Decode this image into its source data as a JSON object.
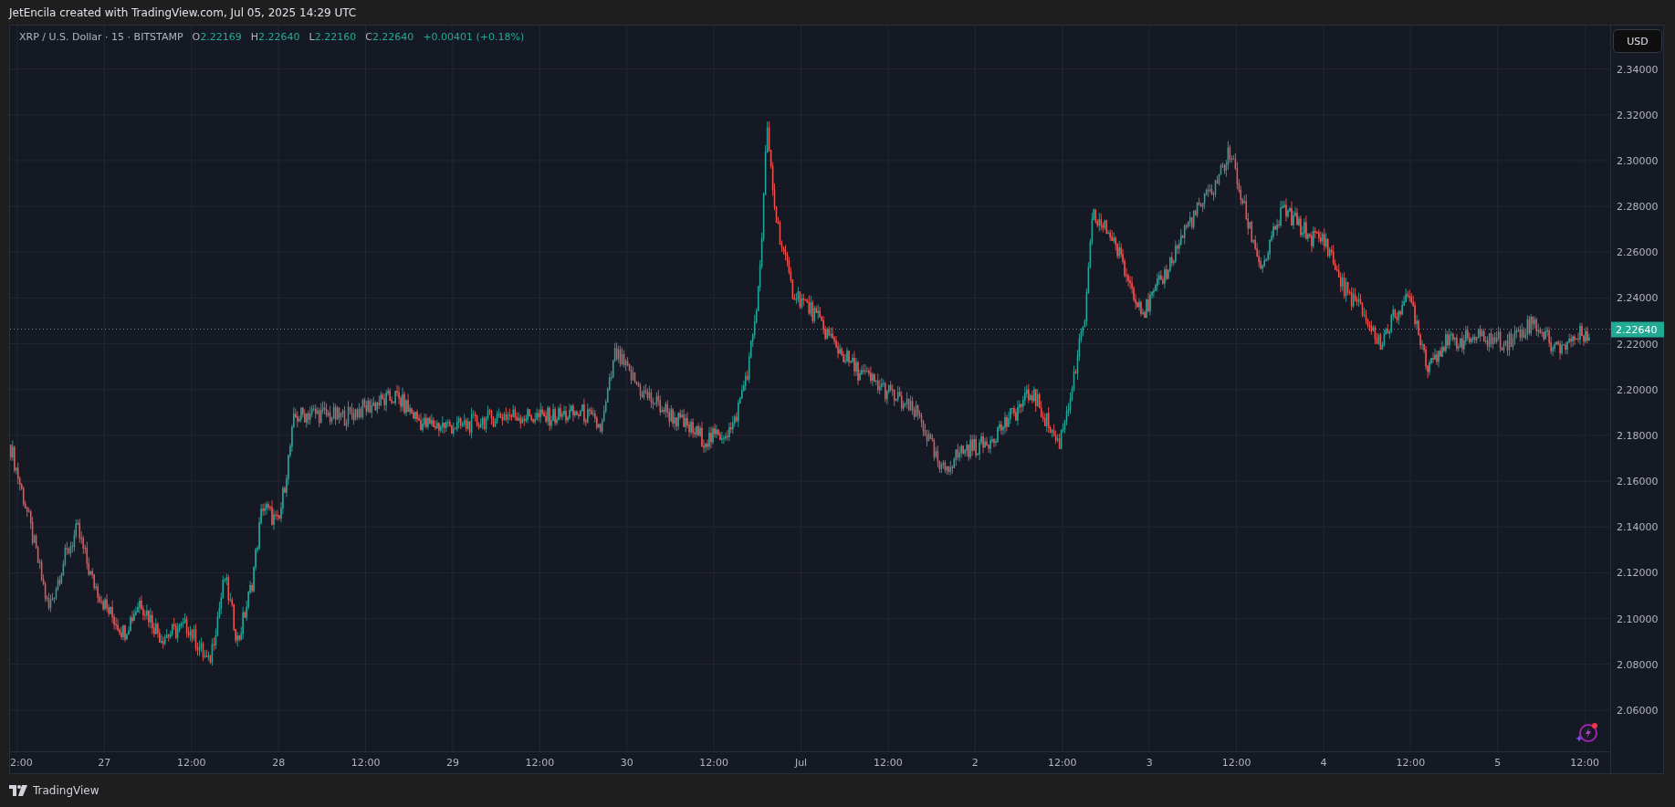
{
  "header": {
    "text": "JetEncila created with TradingView.com, Jul 05, 2025 14:29 UTC"
  },
  "legend": {
    "symbol": "XRP / U.S. Dollar · 15 · BITSTAMP",
    "values": [
      {
        "label": "O",
        "value": "2.22169"
      },
      {
        "label": "H",
        "value": "2.22640"
      },
      {
        "label": "L",
        "value": "2.22160"
      },
      {
        "label": "C",
        "value": "2.22640"
      }
    ],
    "change": "+0.00401 (+0.18%)"
  },
  "currency_button": "USD",
  "last_price": "2.22640",
  "price_axis": [
    "2.34000",
    "2.32000",
    "2.30000",
    "2.28000",
    "2.26000",
    "2.24000",
    "2.22000",
    "2.20000",
    "2.18000",
    "2.16000",
    "2.14000",
    "2.12000",
    "2.10000",
    "2.08000",
    "2.06000"
  ],
  "time_axis": [
    "2:00",
    "27",
    "12:00",
    "28",
    "12:00",
    "29",
    "12:00",
    "30",
    "12:00",
    "Jul",
    "12:00",
    "2",
    "12:00",
    "3",
    "12:00",
    "4",
    "12:00",
    "5",
    "12:00"
  ],
  "footer": {
    "brand": "TradingView"
  }
}
